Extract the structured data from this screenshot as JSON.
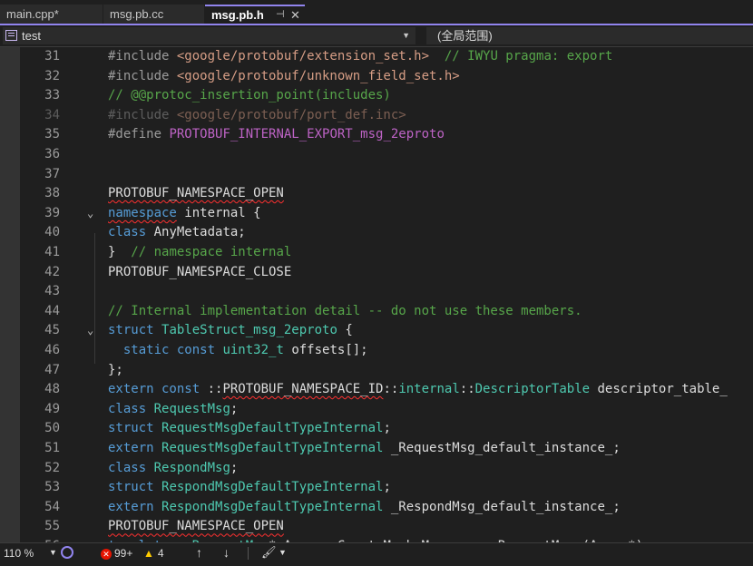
{
  "tabs": [
    {
      "label": "main.cpp*",
      "active": false
    },
    {
      "label": "msg.pb.cc",
      "active": false
    },
    {
      "label": "msg.pb.h",
      "active": true
    }
  ],
  "tab_icons": {
    "pin": "⊣",
    "close": "✕"
  },
  "navbar": {
    "project": "test",
    "scope": "(全局范围)"
  },
  "accent_color": "#9184ee",
  "lines": [
    {
      "n": "31",
      "tokens": [
        [
          "p",
          "#include "
        ],
        [
          "s",
          "<google/protobuf/extension_set.h>"
        ],
        [
          "w",
          "  "
        ],
        [
          "c",
          "// IWYU pragma: export"
        ]
      ]
    },
    {
      "n": "32",
      "tokens": [
        [
          "p",
          "#include "
        ],
        [
          "s",
          "<google/protobuf/unknown_field_set.h>"
        ]
      ]
    },
    {
      "n": "33",
      "tokens": [
        [
          "c",
          "// @@protoc_insertion_point(includes)"
        ]
      ]
    },
    {
      "n": "34",
      "dim": true,
      "tokens": [
        [
          "p",
          "#include "
        ],
        [
          "s",
          "<google/protobuf/port_def.inc>"
        ]
      ]
    },
    {
      "n": "35",
      "tokens": [
        [
          "p",
          "#define "
        ],
        [
          "m",
          "PROTOBUF_INTERNAL_EXPORT_msg_2eproto"
        ]
      ]
    },
    {
      "n": "36",
      "tokens": []
    },
    {
      "n": "37",
      "tokens": []
    },
    {
      "n": "38",
      "tokens": [
        [
          "wq",
          "PROTOBUF_NAMESPACE_OPEN"
        ]
      ]
    },
    {
      "n": "39",
      "fold": true,
      "tokens": [
        [
          "kq",
          "namespace"
        ],
        [
          "w",
          " internal {"
        ]
      ]
    },
    {
      "n": "40",
      "tokens": [
        [
          "k",
          "class"
        ],
        [
          "w",
          " AnyMetadata;"
        ]
      ]
    },
    {
      "n": "41",
      "tokens": [
        [
          "w",
          "}  "
        ],
        [
          "c",
          "// namespace internal"
        ]
      ]
    },
    {
      "n": "42",
      "tokens": [
        [
          "w",
          "PROTOBUF_NAMESPACE_CLOSE"
        ]
      ]
    },
    {
      "n": "43",
      "tokens": []
    },
    {
      "n": "44",
      "tokens": [
        [
          "c",
          "// Internal implementation detail -- do not use these members."
        ]
      ]
    },
    {
      "n": "45",
      "fold": true,
      "tokens": [
        [
          "k",
          "struct"
        ],
        [
          "w",
          " "
        ],
        [
          "t",
          "TableStruct_msg_2eproto"
        ],
        [
          "w",
          " {"
        ]
      ]
    },
    {
      "n": "46",
      "tokens": [
        [
          "w",
          "  "
        ],
        [
          "k",
          "static const"
        ],
        [
          "w",
          " "
        ],
        [
          "t",
          "uint32_t"
        ],
        [
          "w",
          " offsets[];"
        ]
      ]
    },
    {
      "n": "47",
      "tokens": [
        [
          "w",
          "};"
        ]
      ]
    },
    {
      "n": "48",
      "tokens": [
        [
          "k",
          "extern const"
        ],
        [
          "w",
          " ::"
        ],
        [
          "wq",
          "PROTOBUF_NAMESPACE_ID"
        ],
        [
          "w",
          "::"
        ],
        [
          "t",
          "internal"
        ],
        [
          "w",
          "::"
        ],
        [
          "t",
          "DescriptorTable"
        ],
        [
          "w",
          " descriptor_table_"
        ]
      ]
    },
    {
      "n": "49",
      "tokens": [
        [
          "k",
          "class"
        ],
        [
          "w",
          " "
        ],
        [
          "t",
          "RequestMsg"
        ],
        [
          "w",
          ";"
        ]
      ]
    },
    {
      "n": "50",
      "tokens": [
        [
          "k",
          "struct"
        ],
        [
          "w",
          " "
        ],
        [
          "t",
          "RequestMsgDefaultTypeInternal"
        ],
        [
          "w",
          ";"
        ]
      ]
    },
    {
      "n": "51",
      "tokens": [
        [
          "k",
          "extern"
        ],
        [
          "w",
          " "
        ],
        [
          "t",
          "RequestMsgDefaultTypeInternal"
        ],
        [
          "w",
          " _RequestMsg_default_instance_;"
        ]
      ]
    },
    {
      "n": "52",
      "tokens": [
        [
          "k",
          "class"
        ],
        [
          "w",
          " "
        ],
        [
          "t",
          "RespondMsg"
        ],
        [
          "w",
          ";"
        ]
      ]
    },
    {
      "n": "53",
      "tokens": [
        [
          "k",
          "struct"
        ],
        [
          "w",
          " "
        ],
        [
          "t",
          "RespondMsgDefaultTypeInternal"
        ],
        [
          "w",
          ";"
        ]
      ]
    },
    {
      "n": "54",
      "tokens": [
        [
          "k",
          "extern"
        ],
        [
          "w",
          " "
        ],
        [
          "t",
          "RespondMsgDefaultTypeInternal"
        ],
        [
          "w",
          " _RespondMsg_default_instance_;"
        ]
      ]
    },
    {
      "n": "55",
      "tokens": [
        [
          "wq",
          "PROTOBUF_NAMESPACE_OPEN"
        ]
      ]
    },
    {
      "n": "56",
      "partial": true,
      "tokens": [
        [
          "k",
          "template"
        ],
        [
          "w",
          "<> "
        ],
        [
          "t",
          "RequestMsg"
        ],
        [
          "w",
          "* Arena::CreateMaybeMessage<::RequestMsg>(Arena*);"
        ]
      ]
    }
  ],
  "status": {
    "zoom": "110 %",
    "errors": "99+",
    "warnings": "4",
    "up_arrow": "↑",
    "down_arrow": "↓",
    "brush": "🖌"
  }
}
